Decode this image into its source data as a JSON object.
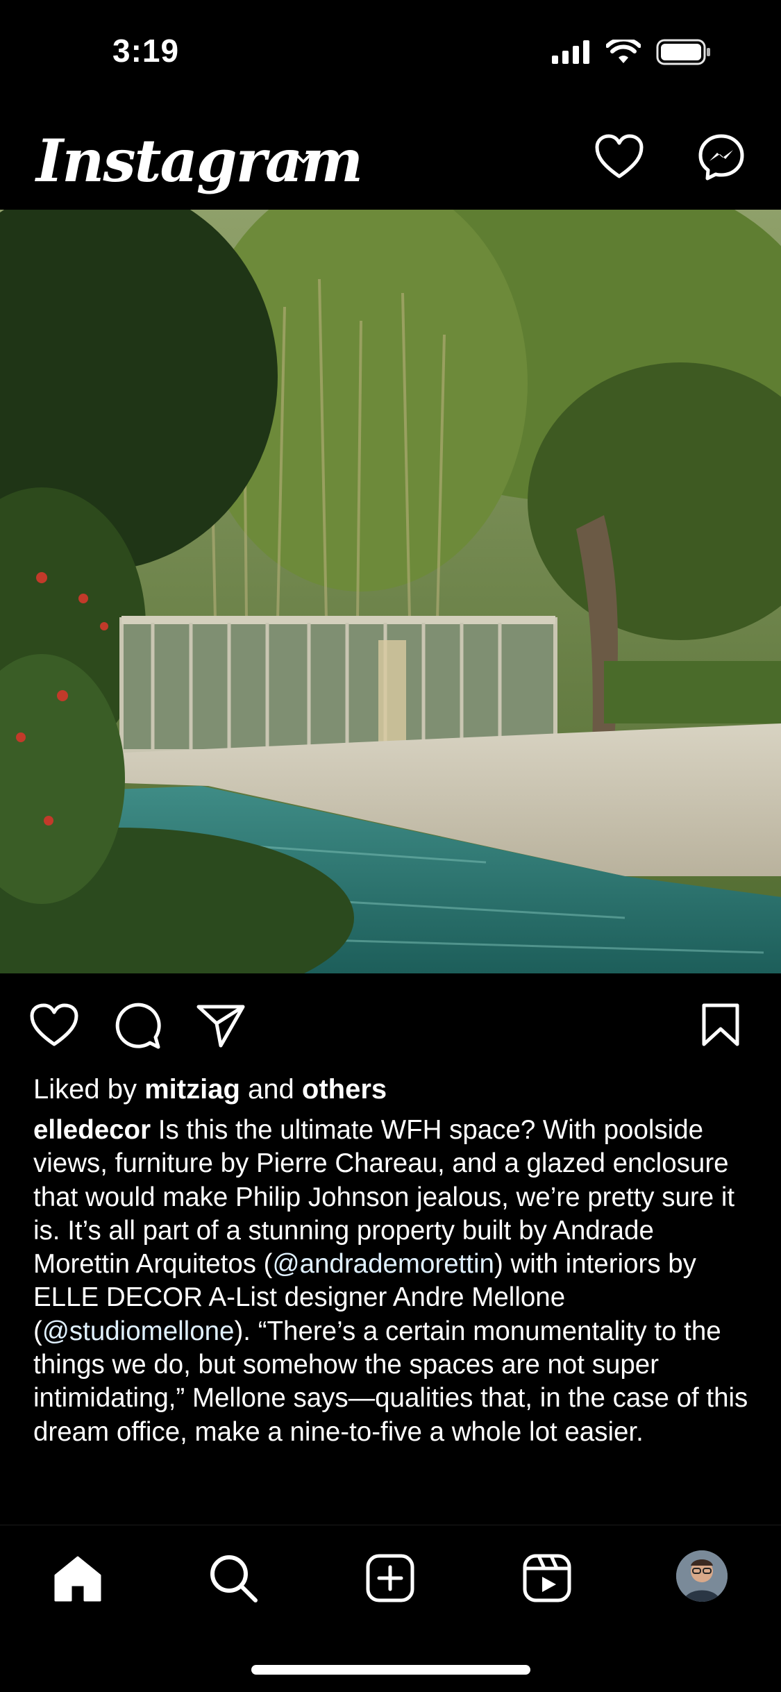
{
  "status_bar": {
    "time": "3:19",
    "icons": [
      "cellular-signal-icon",
      "wifi-icon",
      "battery-icon"
    ]
  },
  "header": {
    "logo_text": "Instagram",
    "icons": [
      "chevron-down-icon",
      "heart-icon",
      "messenger-icon"
    ]
  },
  "post": {
    "image_description_icon": "poolside-glass-pavilion-photo",
    "actions": [
      "like-icon",
      "comment-icon",
      "share-icon",
      "bookmark-icon"
    ],
    "likes": {
      "prefix": "Liked by",
      "user": "mitziag",
      "middle": "and",
      "others": "others"
    },
    "caption": {
      "username": "elledecor",
      "text_1": " Is this the ultimate WFH space? With poolside views, furniture by Pierre Chareau, and a glazed enclosure that would make Philip Johnson jealous, we’re pretty sure it is. It’s all part of a stunning property built by Andrade Morettin Arquitetos (",
      "mention_1": "@andrademorettin",
      "text_2": ") with interiors by ELLE DECOR A-List designer Andre Mellone (",
      "mention_2": "@studiomellone",
      "text_3": "). “There’s a certain monumentality to the things we do, but somehow the spaces are not super intimidating,” Mellone says—qualities that, in the case of this dream office, make a nine-to-five a whole lot easier."
    }
  },
  "bottom_nav": {
    "items": [
      "home-icon",
      "search-icon",
      "create-post-icon",
      "reels-icon",
      "profile-avatar"
    ]
  },
  "colors": {
    "background": "#000000",
    "text": "#ffffff",
    "mention": "#e0f1ff"
  }
}
